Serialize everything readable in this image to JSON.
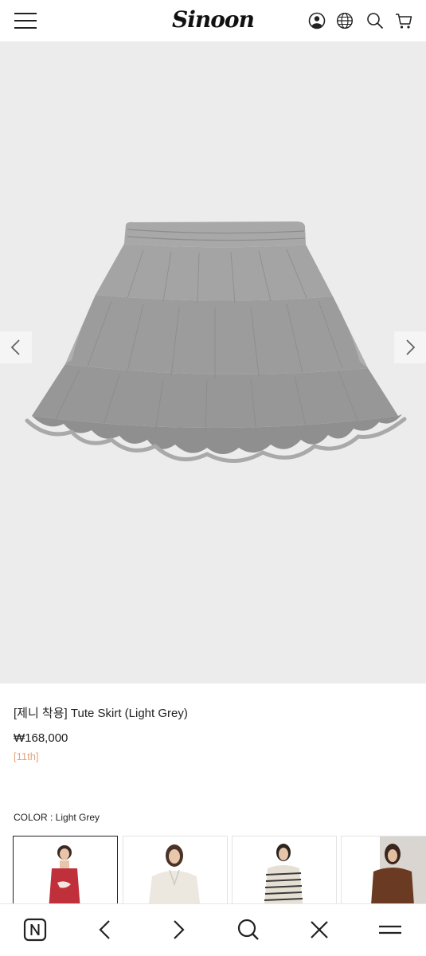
{
  "header": {
    "logo": "Sinoon",
    "icons": [
      "menu-icon",
      "user-icon",
      "globe-icon",
      "search-icon",
      "cart-icon"
    ]
  },
  "hero": {
    "image": "grey tulle tiered mini skirt",
    "background": "#ececec",
    "skirt_color": "#9a9a9a"
  },
  "product": {
    "title": "[제니 착용] Tute Skirt (Light Grey)",
    "price": "₩168,000",
    "tag": "[11th]",
    "color_label": "COLOR : Light Grey"
  },
  "swatches": [
    {
      "name": "red-top",
      "color": "#c0303a",
      "selected": true
    },
    {
      "name": "white-shirt",
      "color": "#ece8e0",
      "selected": false
    },
    {
      "name": "striped-top",
      "color": "#3a3a3a",
      "selected": false
    },
    {
      "name": "brown-jacket",
      "color": "#6b3a22",
      "selected": false
    }
  ],
  "bottom_bar": {
    "icons": [
      "naver-n-icon",
      "back-icon",
      "forward-icon",
      "search-icon",
      "close-icon",
      "menu-icon"
    ]
  },
  "colors": {
    "tag": "#e6a57c",
    "text": "#222222"
  }
}
